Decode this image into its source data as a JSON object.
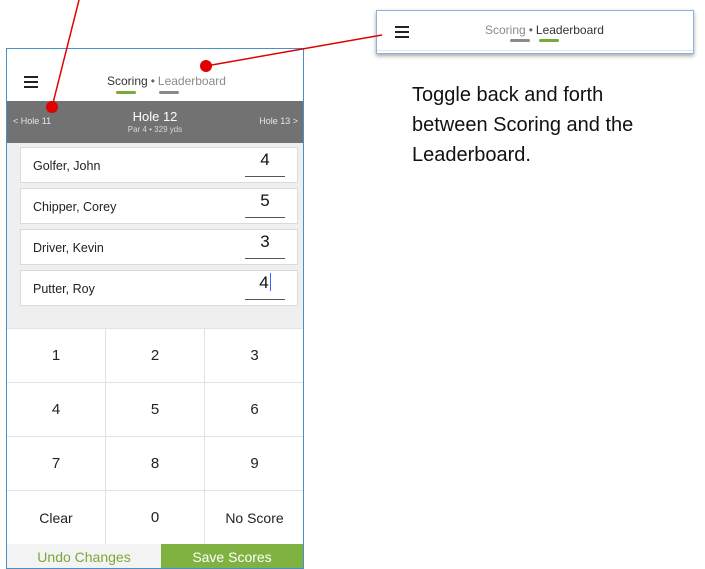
{
  "phone": {
    "tabs": {
      "scoring": "Scoring",
      "separator": "•",
      "leaderboard": "Leaderboard"
    },
    "hole": {
      "prev": "< Hole 11",
      "title": "Hole 12",
      "subtitle": "Par 4 • 329 yds",
      "next": "Hole 13 >"
    },
    "players": [
      {
        "name": "Golfer, John",
        "score": "4"
      },
      {
        "name": "Chipper, Corey",
        "score": "5"
      },
      {
        "name": "Driver, Kevin",
        "score": "3"
      },
      {
        "name": "Putter, Roy",
        "score": "4"
      }
    ],
    "keypad": {
      "k1": "1",
      "k2": "2",
      "k3": "3",
      "k4": "4",
      "k5": "5",
      "k6": "6",
      "k7": "7",
      "k8": "8",
      "k9": "9",
      "clear": "Clear",
      "k0": "0",
      "no_score": "No Score"
    },
    "footer": {
      "undo": "Undo Changes",
      "save": "Save Scores"
    }
  },
  "callout": {
    "tabs": {
      "scoring": "Scoring",
      "separator": "•",
      "leaderboard": "Leaderboard"
    }
  },
  "description": "Toggle back and forth between Scoring and the Leaderboard.",
  "colors": {
    "accent_green": "#7fb241",
    "hole_bar": "#727272",
    "annotation_red": "#e00000",
    "frame_blue": "#4a90c8"
  }
}
